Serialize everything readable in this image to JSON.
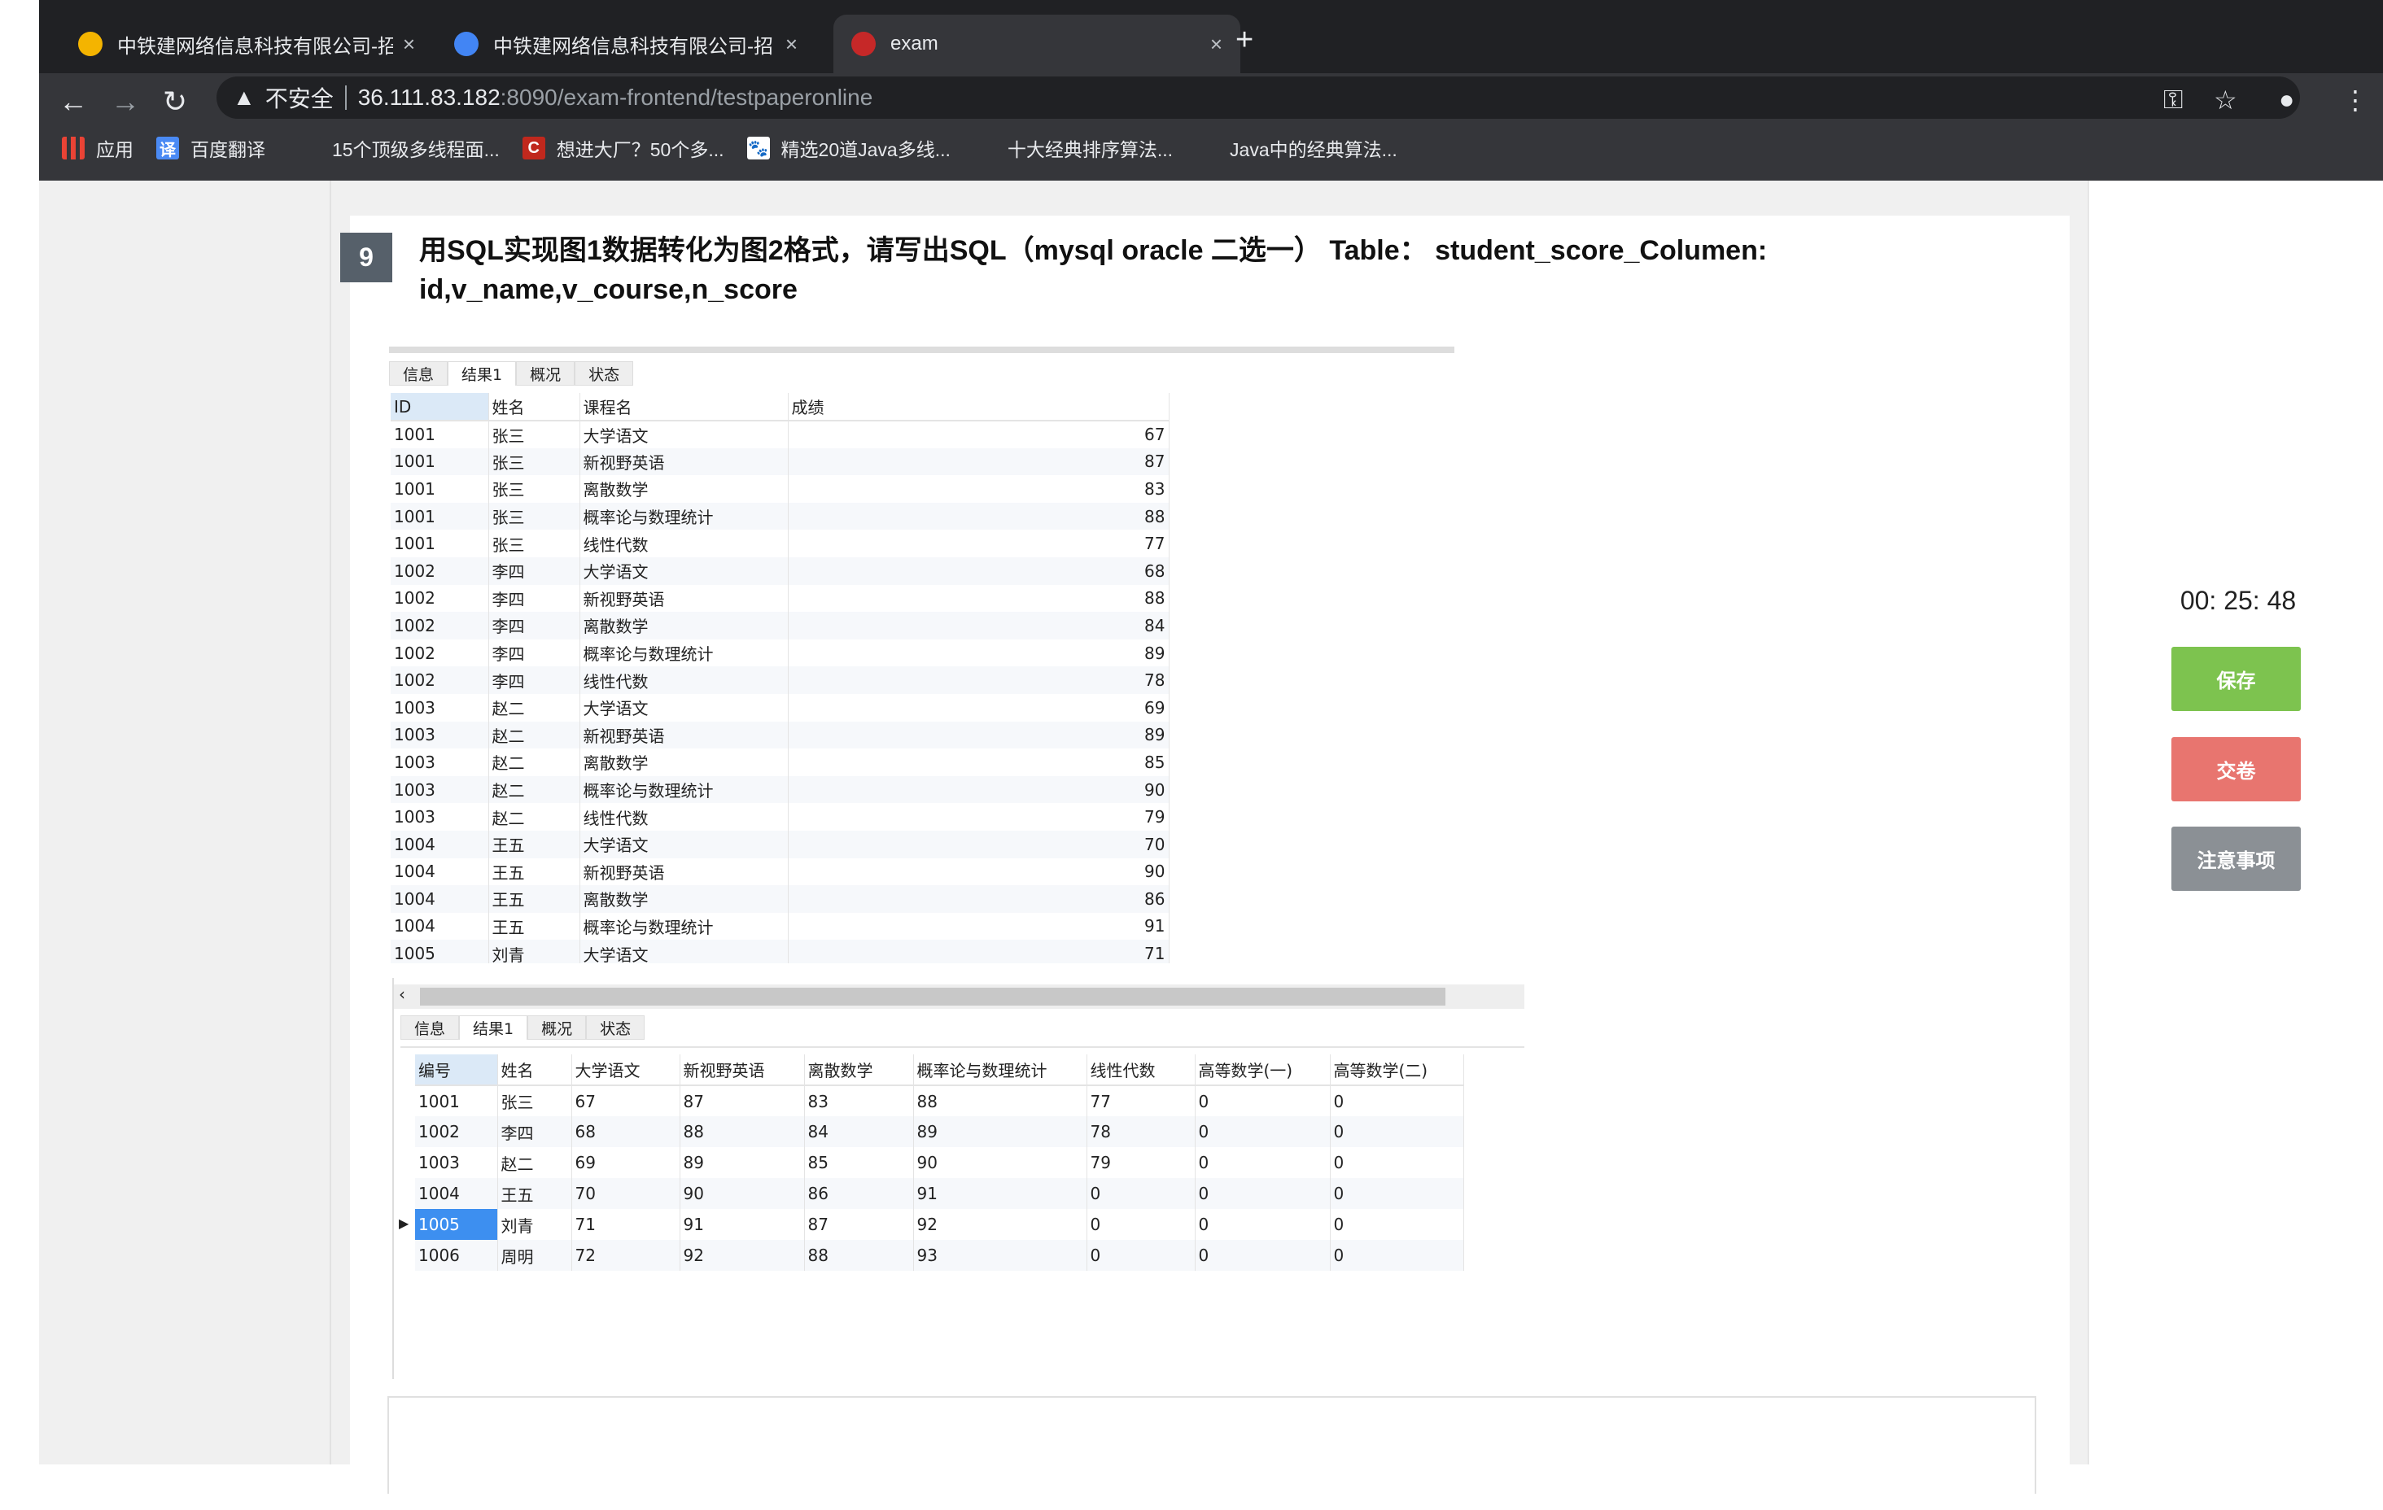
{
  "browser": {
    "tabs": [
      {
        "title": "中铁建网络信息科技有限公司-招",
        "favicon_color": "#f4b400",
        "active": false
      },
      {
        "title": "中铁建网络信息科技有限公司-招",
        "favicon_color": "#4285f4",
        "active": false
      },
      {
        "title": "exam",
        "favicon_color": "#c62828",
        "active": true
      }
    ],
    "new_tab": "+",
    "close": "×",
    "security_label": "不安全",
    "url_host": "36.111.83.182",
    "url_rest": ":8090/exam-frontend/testpaperonline",
    "bookmarks": [
      {
        "label": "应用",
        "icon": "apps-grid-icon",
        "color": "#e8eaed"
      },
      {
        "label": "百度翻译",
        "icon": "translate-icon",
        "color": "#4a8af4",
        "glyph": "译"
      },
      {
        "label": "15个顶级多线程面...",
        "icon": "page-icon",
        "color": "#35363a"
      },
      {
        "label": "想进大厂？50个多...",
        "icon": "csdn-icon",
        "color": "#c0281d",
        "glyph": "C"
      },
      {
        "label": "精选20道Java多线...",
        "icon": "baidu-paw-icon",
        "color": "#ffffff",
        "glyph": "🐾"
      },
      {
        "label": "十大经典排序算法...",
        "icon": "page-icon",
        "color": "#35363a"
      },
      {
        "label": "Java中的经典算法...",
        "icon": "page-icon",
        "color": "#35363a"
      }
    ]
  },
  "question": {
    "number": "9",
    "text": "用SQL实现图1数据转化为图2格式，请写出SQL（mysql oracle 二选一） Table：  student_score_Columen: id,v_name,v_course,n_score"
  },
  "figure1": {
    "tabs": [
      "信息",
      "结果1",
      "概况",
      "状态"
    ],
    "active_tab": "结果1",
    "columns": [
      "ID",
      "姓名",
      "课程名",
      "成绩"
    ],
    "rows": [
      [
        "1001",
        "张三",
        "大学语文",
        "67"
      ],
      [
        "1001",
        "张三",
        "新视野英语",
        "87"
      ],
      [
        "1001",
        "张三",
        "离散数学",
        "83"
      ],
      [
        "1001",
        "张三",
        "概率论与数理统计",
        "88"
      ],
      [
        "1001",
        "张三",
        "线性代数",
        "77"
      ],
      [
        "1002",
        "李四",
        "大学语文",
        "68"
      ],
      [
        "1002",
        "李四",
        "新视野英语",
        "88"
      ],
      [
        "1002",
        "李四",
        "离散数学",
        "84"
      ],
      [
        "1002",
        "李四",
        "概率论与数理统计",
        "89"
      ],
      [
        "1002",
        "李四",
        "线性代数",
        "78"
      ],
      [
        "1003",
        "赵二",
        "大学语文",
        "69"
      ],
      [
        "1003",
        "赵二",
        "新视野英语",
        "89"
      ],
      [
        "1003",
        "赵二",
        "离散数学",
        "85"
      ],
      [
        "1003",
        "赵二",
        "概率论与数理统计",
        "90"
      ],
      [
        "1003",
        "赵二",
        "线性代数",
        "79"
      ],
      [
        "1004",
        "王五",
        "大学语文",
        "70"
      ],
      [
        "1004",
        "王五",
        "新视野英语",
        "90"
      ],
      [
        "1004",
        "王五",
        "离散数学",
        "86"
      ],
      [
        "1004",
        "王五",
        "概率论与数理统计",
        "91"
      ],
      [
        "1005",
        "刘青",
        "大学语文",
        "71"
      ]
    ]
  },
  "figure2": {
    "tabs": [
      "信息",
      "结果1",
      "概况",
      "状态"
    ],
    "active_tab": "结果1",
    "columns": [
      "编号",
      "姓名",
      "大学语文",
      "新视野英语",
      "离散数学",
      "概率论与数理统计",
      "线性代数",
      "高等数学(一)",
      "高等数学(二)"
    ],
    "rows": [
      [
        "1001",
        "张三",
        "67",
        "87",
        "83",
        "88",
        "77",
        "0",
        "0"
      ],
      [
        "1002",
        "李四",
        "68",
        "88",
        "84",
        "89",
        "78",
        "0",
        "0"
      ],
      [
        "1003",
        "赵二",
        "69",
        "89",
        "85",
        "90",
        "79",
        "0",
        "0"
      ],
      [
        "1004",
        "王五",
        "70",
        "90",
        "86",
        "91",
        "0",
        "0",
        "0"
      ],
      [
        "1005",
        "刘青",
        "71",
        "91",
        "87",
        "92",
        "0",
        "0",
        "0"
      ],
      [
        "1006",
        "周明",
        "72",
        "92",
        "88",
        "93",
        "0",
        "0",
        "0"
      ]
    ],
    "selected_row": 4
  },
  "sidebar": {
    "timer": "00: 25: 48",
    "save": "保存",
    "save_color": "#7dc34f",
    "submit": "交卷",
    "submit_color": "#e8756f",
    "notes": "注意事项",
    "notes_color": "#8b9095"
  }
}
